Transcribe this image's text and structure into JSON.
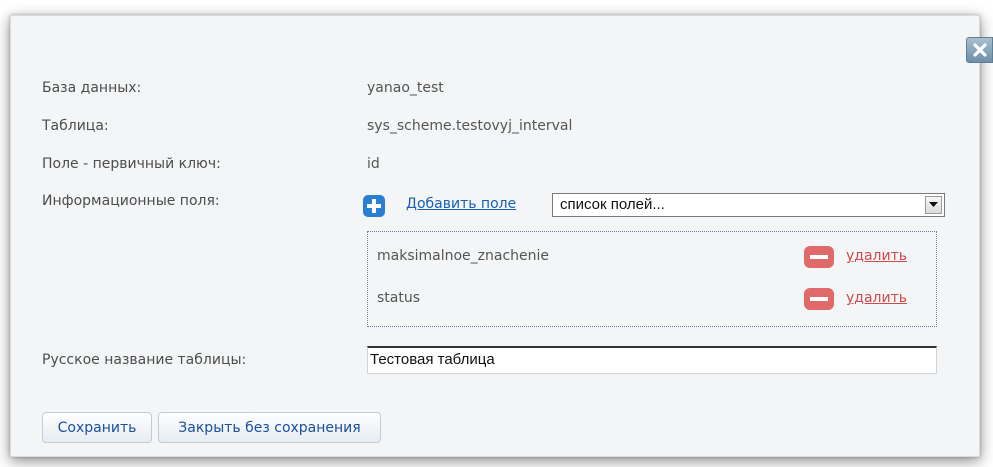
{
  "dialog": {
    "close_icon": "close-icon",
    "rows": {
      "database": {
        "label": "База данных:",
        "value": "yanao_test"
      },
      "table": {
        "label": "Таблица:",
        "value": "sys_scheme.testovyj_interval"
      },
      "primary_key": {
        "label": "Поле - первичный ключ:",
        "value": "id"
      },
      "info_fields": {
        "label": "Информационные поля:"
      }
    },
    "add_field": {
      "icon": "plus-icon",
      "label": "Добавить поле"
    },
    "fields_select": {
      "selected": "список полей..."
    },
    "fields": [
      {
        "name": "maksimalnoe_znachenie",
        "remove_label": "удалить",
        "remove_icon": "minus-icon"
      },
      {
        "name": "status",
        "remove_label": "удалить",
        "remove_icon": "minus-icon"
      }
    ],
    "russian_name": {
      "label": "Русское название таблицы:",
      "value": "Тестовая таблица"
    },
    "buttons": {
      "save": "Сохранить",
      "close_without_save": "Закрыть без сохранения"
    },
    "colors": {
      "link": "#1a5fb4",
      "remove_link": "#d24a4a",
      "add_icon": "#2a7fd4",
      "remove_icon": "#e06a6a"
    }
  }
}
